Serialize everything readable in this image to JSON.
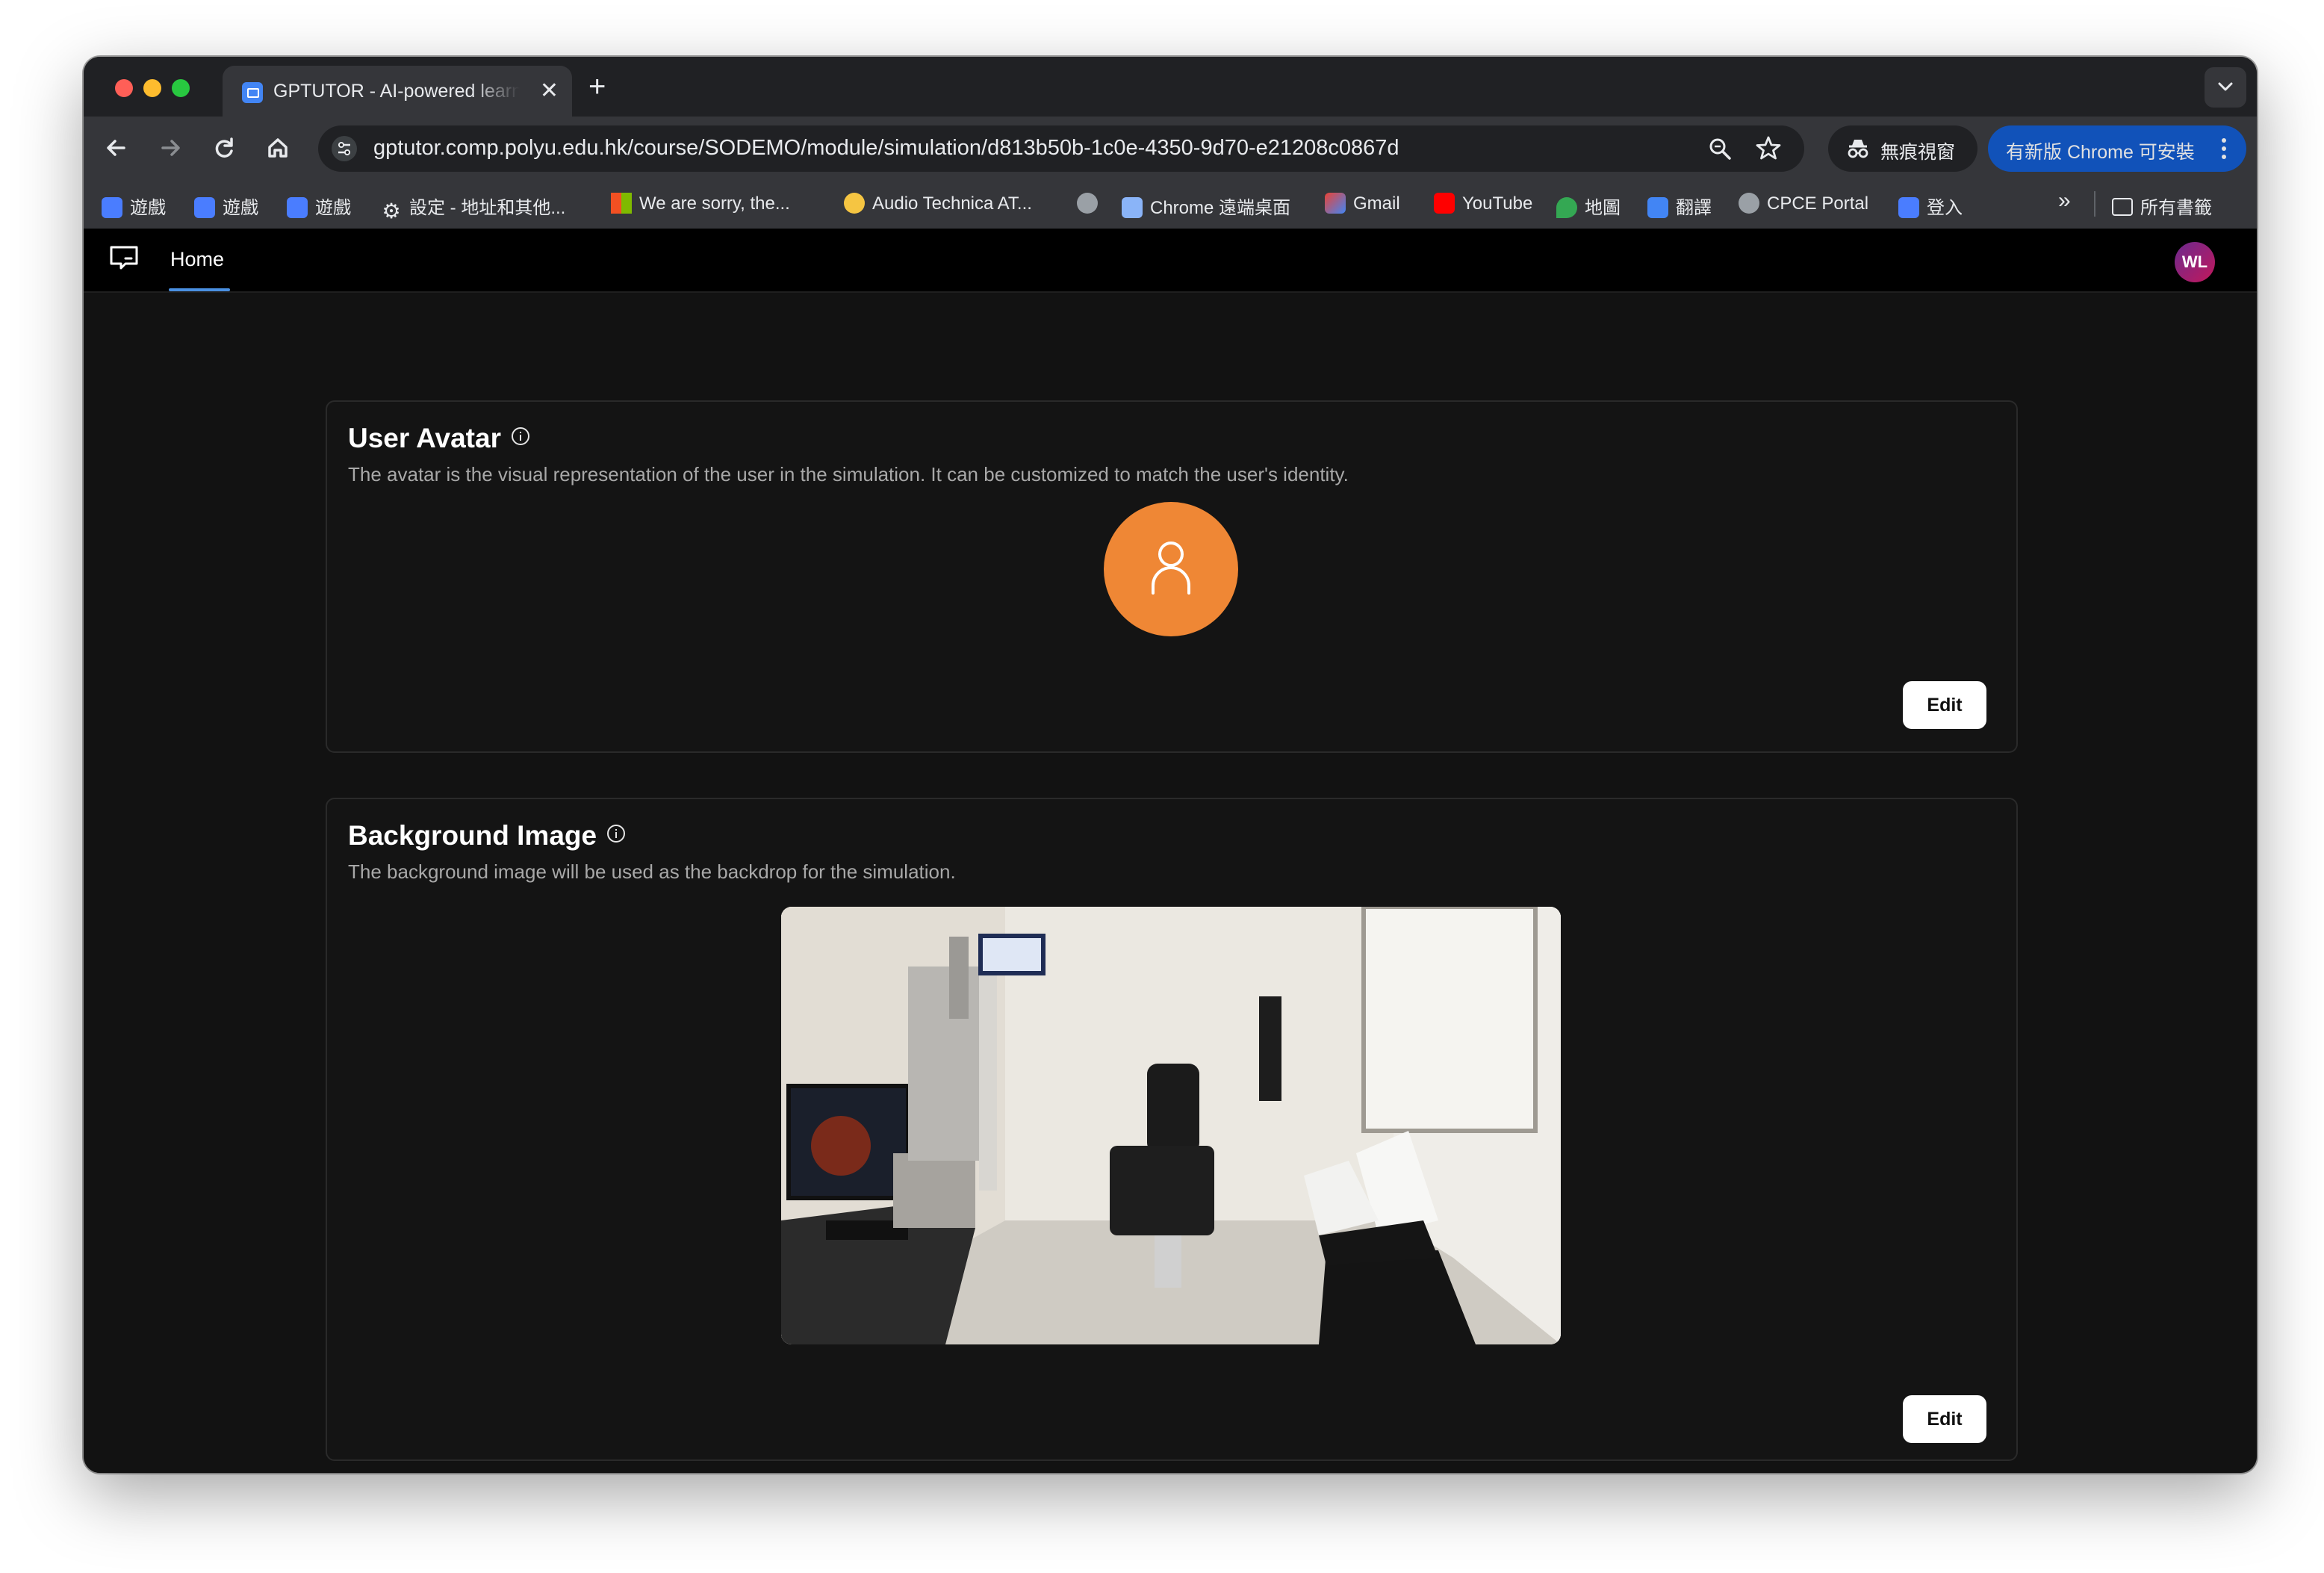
{
  "browser": {
    "tab_title": "GPTUTOR - AI-powered learn",
    "tab_close": "✕",
    "new_tab": "+",
    "url": "gptutor.comp.polyu.edu.hk/course/SODEMO/module/simulation/d813b50b-1c0e-4350-9d70-e21208c0867d",
    "incognito_label": "無痕視窗",
    "update_label": "有新版 Chrome 可安裝",
    "bookmarks": [
      {
        "label": "遊戲",
        "icon": "app-icon"
      },
      {
        "label": "遊戲",
        "icon": "app-icon"
      },
      {
        "label": "遊戲",
        "icon": "app-icon"
      },
      {
        "label": "設定 - 地址和其他...",
        "icon": "gear-icon"
      },
      {
        "label": "We are sorry, the...",
        "icon": "microsoft-icon"
      },
      {
        "label": "Audio Technica AT...",
        "icon": "chat-bubble-icon"
      },
      {
        "label": "",
        "icon": "globe-icon"
      },
      {
        "label": "Chrome 遠端桌面",
        "icon": "remote-desktop-icon"
      },
      {
        "label": "Gmail",
        "icon": "gmail-icon"
      },
      {
        "label": "YouTube",
        "icon": "youtube-icon"
      },
      {
        "label": "地圖",
        "icon": "maps-icon"
      },
      {
        "label": "翻譯",
        "icon": "translate-icon"
      },
      {
        "label": "CPCE Portal",
        "icon": "globe-icon"
      },
      {
        "label": "登入",
        "icon": "app-icon"
      }
    ],
    "more_bookmarks": "»",
    "all_bookmarks": "所有書籤"
  },
  "app": {
    "nav_home": "Home",
    "user_initials": "WL"
  },
  "user_avatar_card": {
    "title": "User Avatar",
    "description": "The avatar is the visual representation of the user in the simulation. It can be customized to match the user's identity.",
    "edit_label": "Edit"
  },
  "background_card": {
    "title": "Background Image",
    "description": "The background image will be used as the backdrop for the simulation.",
    "image_alt": "Eye examination room",
    "edit_label": "Edit"
  },
  "colors": {
    "accent": "#4a90e2",
    "avatar": "#ef8735",
    "update_button": "#0b57d0"
  }
}
